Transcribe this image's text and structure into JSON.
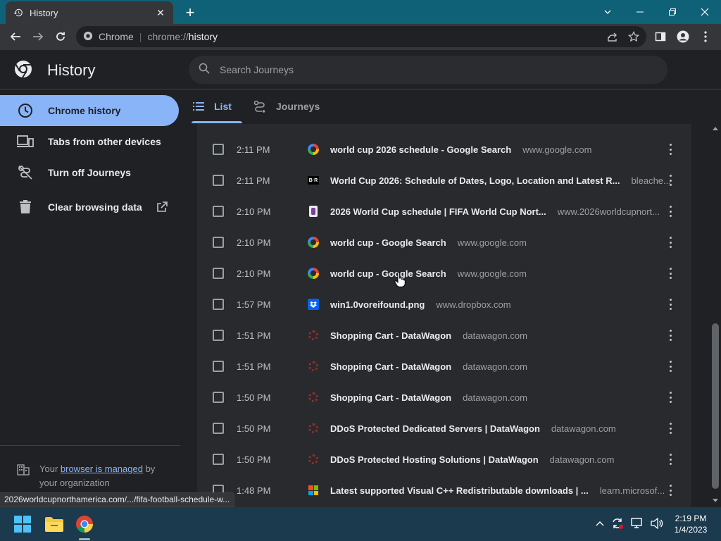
{
  "window": {
    "tab_title": "History",
    "tab_close": "✕",
    "new_tab": "+"
  },
  "omnibox": {
    "chrome_label": "Chrome",
    "url_scheme": "chrome://",
    "url_path": "history"
  },
  "header": {
    "title": "History",
    "search_placeholder": "Search Journeys"
  },
  "sidebar": {
    "items": [
      {
        "label": "Chrome history",
        "icon": "clock-icon",
        "active": true
      },
      {
        "label": "Tabs from other devices",
        "icon": "devices-icon",
        "active": false
      },
      {
        "label": "Turn off Journeys",
        "icon": "journeys-off-icon",
        "active": false
      },
      {
        "label": "Clear browsing data",
        "icon": "trash-icon",
        "active": false
      }
    ],
    "managed_prefix": "Your ",
    "managed_link": "browser is managed",
    "managed_suffix": " by your organization"
  },
  "view_tabs": {
    "list": "List",
    "journeys": "Journeys"
  },
  "history_rows": [
    {
      "time": "2:11 PM",
      "favicon": "google",
      "title": "world cup 2026 schedule - Google Search",
      "domain": "www.google.com"
    },
    {
      "time": "2:11 PM",
      "favicon": "bleacher",
      "title": "World Cup 2026: Schedule of Dates, Logo, Location and Latest R...",
      "domain": "bleache..."
    },
    {
      "time": "2:10 PM",
      "favicon": "fifa",
      "title": "2026 World Cup schedule | FIFA World Cup Nort...",
      "domain": "www.2026worldcupnort..."
    },
    {
      "time": "2:10 PM",
      "favicon": "google",
      "title": "world cup - Google Search",
      "domain": "www.google.com"
    },
    {
      "time": "2:10 PM",
      "favicon": "google",
      "title": "world cup - Google Search",
      "domain": "www.google.com"
    },
    {
      "time": "1:57 PM",
      "favicon": "dropbox",
      "title": "win1.0voreifound.png",
      "domain": "www.dropbox.com"
    },
    {
      "time": "1:51 PM",
      "favicon": "datawagon",
      "title": "Shopping Cart - DataWagon",
      "domain": "datawagon.com"
    },
    {
      "time": "1:51 PM",
      "favicon": "datawagon",
      "title": "Shopping Cart - DataWagon",
      "domain": "datawagon.com"
    },
    {
      "time": "1:50 PM",
      "favicon": "datawagon",
      "title": "Shopping Cart - DataWagon",
      "domain": "datawagon.com"
    },
    {
      "time": "1:50 PM",
      "favicon": "datawagon",
      "title": "DDoS Protected Dedicated Servers | DataWagon",
      "domain": "datawagon.com"
    },
    {
      "time": "1:50 PM",
      "favicon": "datawagon",
      "title": "DDoS Protected Hosting Solutions | DataWagon",
      "domain": "datawagon.com"
    },
    {
      "time": "1:48 PM",
      "favicon": "microsoft",
      "title": "Latest supported Visual C++ Redistributable downloads | ...",
      "domain": "learn.microsof..."
    }
  ],
  "status_url": "2026worldcupnorthamerica.com/.../fifa-football-schedule-w...",
  "taskbar": {
    "time": "2:19 PM",
    "date": "1/4/2023"
  },
  "colors": {
    "accent": "#8ab4f8",
    "titlebar": "#0f6177",
    "taskbar": "#1c3a4d"
  }
}
